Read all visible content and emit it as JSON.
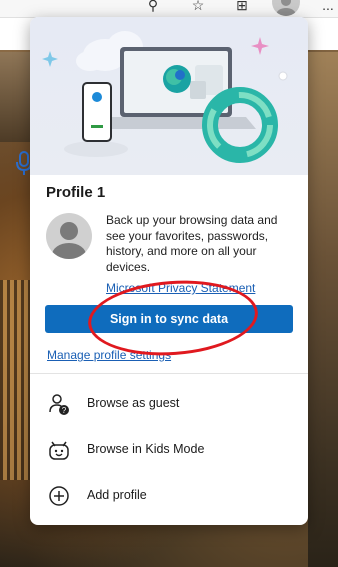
{
  "toolbar": {
    "icons": [
      "add-profile-icon",
      "favorites-icon",
      "collections-icon",
      "profile-avatar",
      "more-icon"
    ],
    "more_label": "..."
  },
  "background_page": {
    "mic_icon": "microphone-icon"
  },
  "panel": {
    "profile_name": "Profile 1",
    "description": "Back up your browsing data and see your favorites, passwords, history, and more on all your devices.",
    "privacy_link": "Microsoft Privacy Statement",
    "signin_button": "Sign in to sync data",
    "manage_link": "Manage profile settings",
    "menu": [
      {
        "label": "Browse as guest",
        "icon": "guest-icon"
      },
      {
        "label": "Browse in Kids Mode",
        "icon": "kids-mode-icon"
      },
      {
        "label": "Add profile",
        "icon": "add-circle-icon"
      }
    ]
  },
  "colors": {
    "accent": "#0f6cbd",
    "link": "#1a5fb4",
    "annotation": "#e0191f"
  }
}
